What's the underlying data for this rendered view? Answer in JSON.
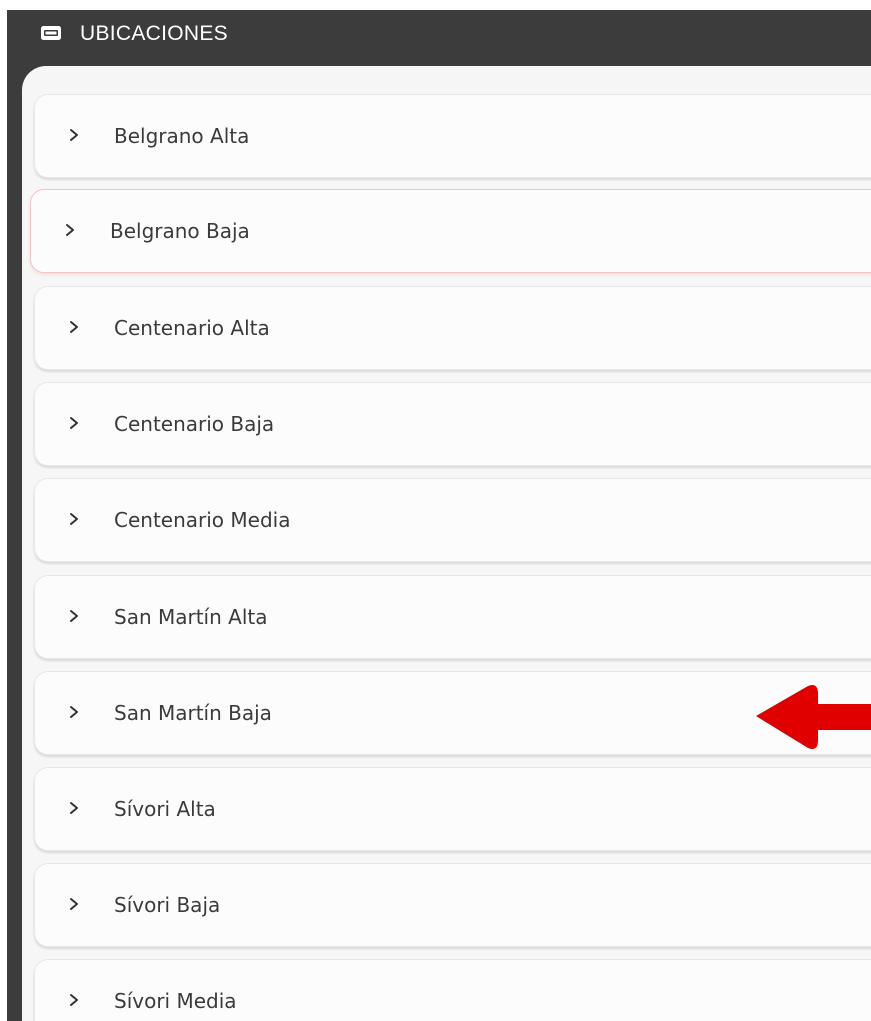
{
  "header": {
    "title": "UBICACIONES",
    "icon": "ticket-icon"
  },
  "locations": [
    {
      "label": "Belgrano Alta"
    },
    {
      "label": "Belgrano Baja",
      "highlighted": true
    },
    {
      "label": "Centenario Alta"
    },
    {
      "label": "Centenario Baja"
    },
    {
      "label": "Centenario Media"
    },
    {
      "label": "San Martín Alta"
    },
    {
      "label": "San Martín Baja",
      "pointed_by_arrow": true
    },
    {
      "label": "Sívori Alta"
    },
    {
      "label": "Sívori Baja"
    },
    {
      "label": "Sívori Media"
    }
  ],
  "colors": {
    "header_bg": "#3c3c3c",
    "list_bg": "#f6f6f6",
    "item_bg": "#fcfcfc",
    "highlight_border": "#f3c4c4",
    "annotation_arrow": "#e00000"
  }
}
